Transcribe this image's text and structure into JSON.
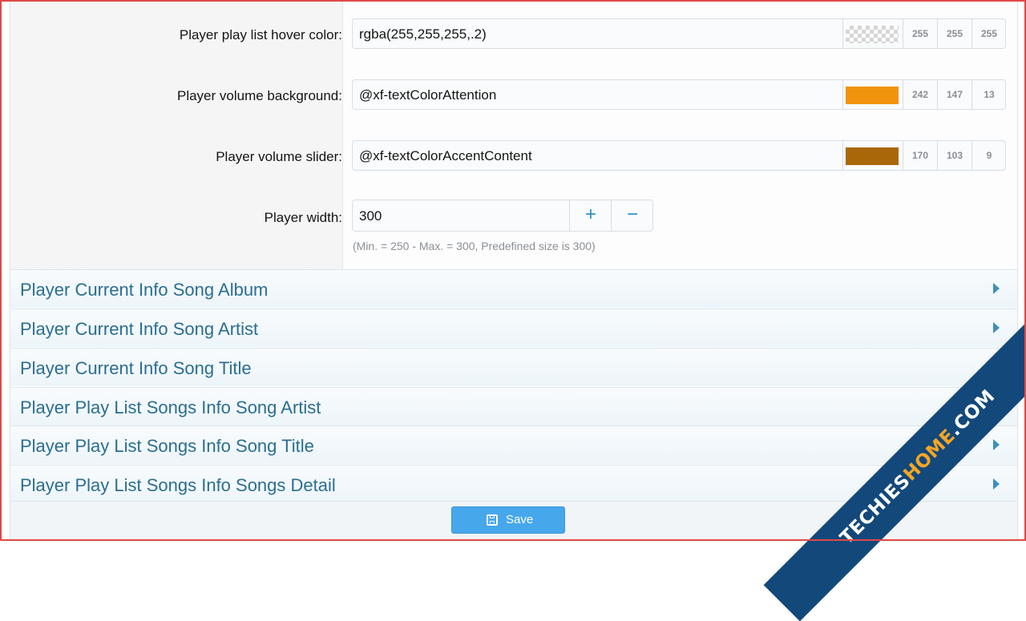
{
  "colors": {
    "swatch_volume_bg": "#f2930d",
    "swatch_volume_slider": "#aa6709",
    "accent": "#47a7eb",
    "ribbon_bg": "#13487a",
    "ribbon_accent": "#f6a623"
  },
  "rows": [
    {
      "label": "Player play list hover color:",
      "value": "rgba(255,255,255,.2)",
      "r": "255",
      "g": "255",
      "b": "255",
      "swatch": "transparent-checker"
    },
    {
      "label": "Player volume background:",
      "value": "@xf-textColorAttention",
      "r": "242",
      "g": "147",
      "b": "13",
      "swatch": "#f2930d"
    },
    {
      "label": "Player volume slider:",
      "value": "@xf-textColorAccentContent",
      "r": "170",
      "g": "103",
      "b": "9",
      "swatch": "#aa6709"
    }
  ],
  "width_field": {
    "label": "Player width:",
    "value": "300",
    "plus": "+",
    "minus": "−",
    "hint": "(Min. = 250 - Max. = 300, Predefined size is 300)"
  },
  "sections": [
    "Player Current Info Song Album",
    "Player Current Info Song Artist",
    "Player Current Info Song Title",
    "Player Play List Songs Info Song Artist",
    "Player Play List Songs Info Song Title",
    "Player Play List Songs Info Songs Detail"
  ],
  "save_button": {
    "label": "Save",
    "icon": "save-icon"
  },
  "watermark": {
    "part1": "TECHIES",
    "part2": "HOME",
    "part3": ".COM"
  }
}
